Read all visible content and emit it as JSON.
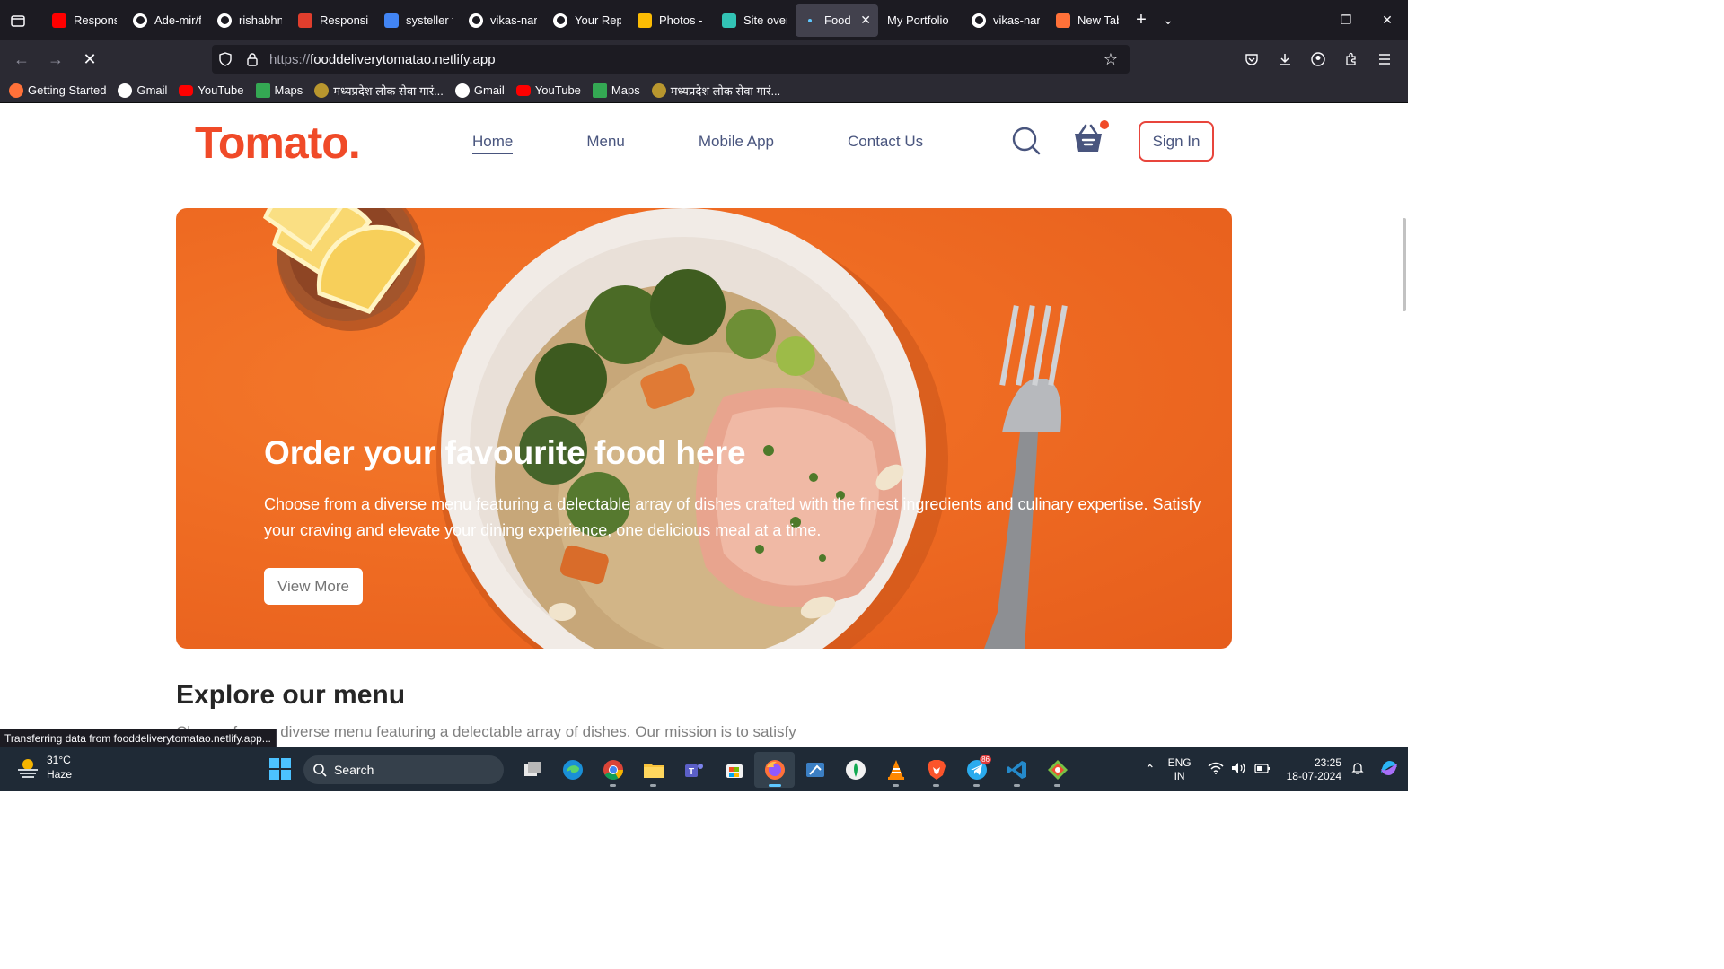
{
  "browser": {
    "tabs": [
      {
        "label": "Responsiv",
        "icon": "youtube-icon",
        "color": "#ff0000"
      },
      {
        "label": "Ade-mir/f",
        "icon": "github-icon",
        "color": "#ffffff"
      },
      {
        "label": "rishabhnn",
        "icon": "github-icon",
        "color": "#ffffff"
      },
      {
        "label": "Responsiv",
        "icon": "codepen-icon",
        "color": "#e03e2d"
      },
      {
        "label": "systeller t",
        "icon": "google-icon",
        "color": "#4285f4"
      },
      {
        "label": "vikas-narv",
        "icon": "github-icon",
        "color": "#ffffff"
      },
      {
        "label": "Your Repo",
        "icon": "github-icon",
        "color": "#ffffff"
      },
      {
        "label": "Photos - C",
        "icon": "photos-icon",
        "color": "#fbbc04"
      },
      {
        "label": "Site overv",
        "icon": "netlify-icon",
        "color": "#32c3b5"
      },
      {
        "label": "Food D",
        "icon": "loading-dot-icon",
        "color": "#5ec8ff",
        "active": true
      },
      {
        "label": "My Portfolio",
        "icon": "",
        "color": ""
      },
      {
        "label": "vikas-narv",
        "icon": "github-icon",
        "color": "#ffffff"
      },
      {
        "label": "New Tab",
        "icon": "firefox-icon",
        "color": "#ff7139"
      }
    ],
    "url_proto": "https://",
    "url_host": "fooddeliverytomatao.netlify.app",
    "bookmarks": [
      {
        "label": "Getting Started",
        "icon": "firefox-icon"
      },
      {
        "label": "Gmail",
        "icon": "google-icon"
      },
      {
        "label": "YouTube",
        "icon": "youtube-icon"
      },
      {
        "label": "Maps",
        "icon": "maps-icon"
      },
      {
        "label": "मध्यप्रदेश लोक सेवा गारं...",
        "icon": "mp-seal-icon"
      },
      {
        "label": "Gmail",
        "icon": "google-icon"
      },
      {
        "label": "YouTube",
        "icon": "youtube-icon"
      },
      {
        "label": "Maps",
        "icon": "maps-icon"
      },
      {
        "label": "मध्यप्रदेश लोक सेवा गारं...",
        "icon": "mp-seal-icon"
      }
    ],
    "status_text": "Transferring data from fooddeliverytomatao.netlify.app..."
  },
  "site": {
    "logo": "Tomato.",
    "nav": [
      "Home",
      "Menu",
      "Mobile App",
      "Contact Us"
    ],
    "active_nav": "Home",
    "signin_label": "Sign In",
    "brand_color": "#f04a28",
    "hero": {
      "title": "Order your favourite food here",
      "description": "Choose from a diverse menu featuring a delectable array of dishes crafted with the finest ingredients and culinary expertise. Satisfy your craving and elevate your dining experience, one delicious meal at a time.",
      "button": "View More",
      "bg_color": "#ef6c23"
    },
    "explore": {
      "title": "Explore our menu",
      "description": "Choose from a diverse menu featuring a delectable array of dishes. Our mission is to satisfy your"
    }
  },
  "taskbar": {
    "weather_temp": "31°C",
    "weather_desc": "Haze",
    "search_label": "Search",
    "telegram_badge": "86",
    "lang_line1": "ENG",
    "lang_line2": "IN",
    "time": "23:25",
    "date": "18-07-2024"
  }
}
